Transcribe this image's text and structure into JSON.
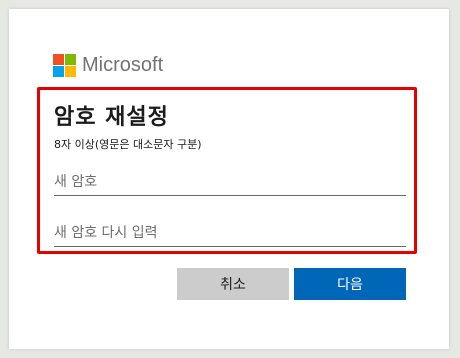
{
  "brand": {
    "name": "Microsoft",
    "logo_colors": [
      "#f25022",
      "#7fba00",
      "#00a4ef",
      "#ffb900"
    ],
    "logo_icon": "microsoft-logo-icon"
  },
  "dialog": {
    "title": "암호 재설정",
    "subtitle": "8자 이상(영문은 대소문자 구분)",
    "new_password_placeholder": "새 암호",
    "confirm_password_placeholder": "새 암호 다시 입력",
    "highlight_color": "#e60000"
  },
  "buttons": {
    "cancel_label": "취소",
    "next_label": "다음",
    "primary_color": "#0067b8",
    "secondary_color": "#cccccc"
  }
}
